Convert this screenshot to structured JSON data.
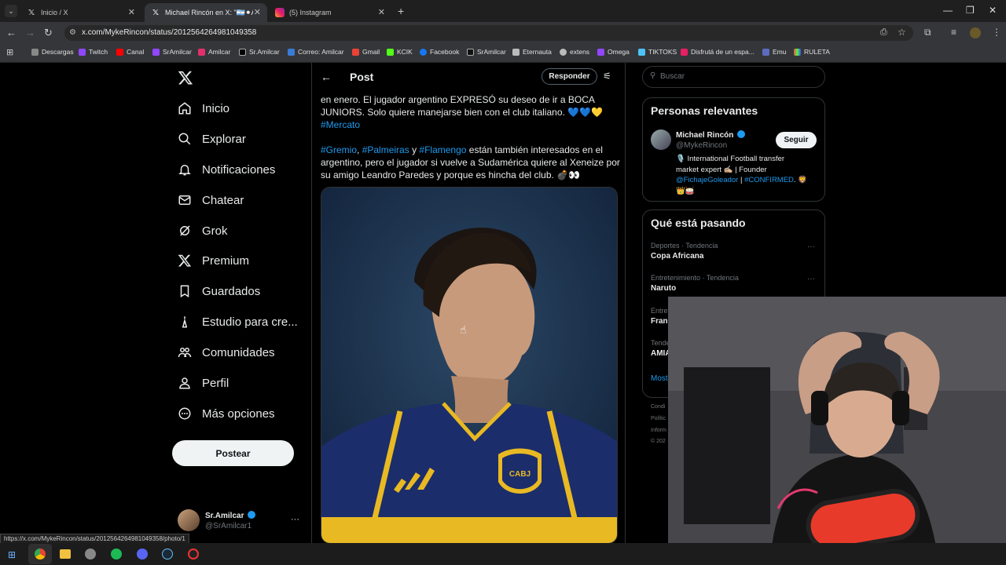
{
  "browser": {
    "tabs": [
      {
        "label": "Inicio / X",
        "icon": "x-logo-icon"
      },
      {
        "label": "Michael Rincón en X: \"🇦🇷⚫Al",
        "icon": "x-logo-icon"
      },
      {
        "label": "(5) Instagram",
        "icon": "instagram-icon"
      }
    ],
    "new_tab": "+",
    "url": "x.com/MykeRincon/status/2012564264981049358",
    "status_url": "https://x.com/MykeRincon/status/2012564264981049358/photo/1",
    "bookmarks": [
      "Descargas",
      "Twitch",
      "Canal",
      "SrAmilcar",
      "Amilcar",
      "Sr.Amilcar",
      "Correo: Amilcar",
      "Gmail",
      "KCIK",
      "Facebook",
      "SrAmilcar",
      "Eternauta",
      "extens",
      "Omega",
      "TIKTOKS",
      "Disfrutá de un espa...",
      "Emu",
      "RULETA"
    ]
  },
  "nav": {
    "items": [
      "Inicio",
      "Explorar",
      "Notificaciones",
      "Chatear",
      "Grok",
      "Premium",
      "Guardados",
      "Estudio para cre...",
      "Comunidades",
      "Perfil",
      "Más opciones"
    ],
    "post_button": "Postear",
    "account": {
      "name": "Sr.Amilcar",
      "handle": "@SrAmilcar1",
      "more": "···"
    }
  },
  "post": {
    "header_title": "Post",
    "reply_button": "Responder",
    "text_line1": "en enero. El jugador argentino EXPRESÓ su deseo de ir a BOCA",
    "text_line2": "JUNIORS. Solo quiere manejarse bien con el club italiano. 💙💙💛",
    "tag_mercato": "#Mercato",
    "tag_gremio": "#Gremio",
    "tag_palmeiras": "#Palmeiras",
    "tag_flamengo": "#Flamengo",
    "sep1": ",",
    "sep2": " y",
    "text_line3": " están también interesados en el",
    "text_line4": "argentino, pero el jugador si vuelve a Sudamérica quiere al Xeneize por",
    "text_line5": "su amigo Leandro Paredes y porque es hincha del club. 💣👀",
    "photo_badge": "CABJ"
  },
  "sidebar": {
    "search_placeholder": "Buscar",
    "relevant_title": "Personas relevantes",
    "person": {
      "name": "Michael Rincón",
      "handle": "@MykeRincon",
      "follow": "Seguir",
      "bio_line1": "🎙️ International Football transfer",
      "bio_line2": "market expert ✍🏼 | Founder",
      "bio_mention": "@FichajeGoleador",
      "bio_sep": " | ",
      "bio_hashtag": "#CONFIRMED",
      "bio_end": ". 🦁",
      "bio_line4": "👑🥁"
    },
    "trending_title": "Qué está pasando",
    "trends": [
      {
        "context": "Deportes · Tendencia",
        "name": "Copa Africana"
      },
      {
        "context": "Entretenimiento · Tendencia",
        "name": "Naruto"
      },
      {
        "context": "Entre",
        "name": "Fran"
      },
      {
        "context": "Tende",
        "name": "AMIA"
      }
    ],
    "show_more": "Most",
    "footer": [
      "Condi",
      "Polític",
      "Inform",
      "© 202"
    ]
  }
}
